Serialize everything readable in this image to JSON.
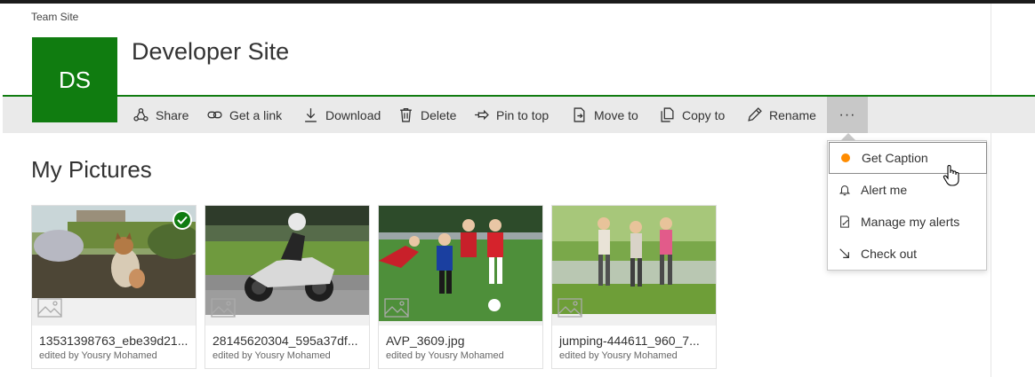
{
  "breadcrumb": "Team Site",
  "site": {
    "initials": "DS",
    "title": "Developer Site",
    "logo_color": "#107c10"
  },
  "commands": [
    {
      "label": "Share",
      "icon": "share-icon"
    },
    {
      "label": "Get a link",
      "icon": "link-icon"
    },
    {
      "label": "Download",
      "icon": "download-icon"
    },
    {
      "label": "Delete",
      "icon": "trash-icon"
    },
    {
      "label": "Pin to top",
      "icon": "pin-icon"
    },
    {
      "label": "Move to",
      "icon": "move-icon"
    },
    {
      "label": "Copy to",
      "icon": "copy-icon"
    },
    {
      "label": "Rename",
      "icon": "pencil-icon"
    }
  ],
  "more_label": "···",
  "menu": {
    "items": [
      {
        "label": "Get Caption",
        "icon": "orange-dot-icon",
        "hovered": true
      },
      {
        "label": "Alert me",
        "icon": "bell-icon"
      },
      {
        "label": "Manage my alerts",
        "icon": "manage-alerts-icon"
      },
      {
        "label": "Check out",
        "icon": "check-out-icon"
      }
    ]
  },
  "section_title": "My Pictures",
  "files": [
    {
      "name": "13531398763_ebe39d21...",
      "editor": "edited by Yousry Mohamed",
      "selected": true,
      "icon": "image-placeholder-icon"
    },
    {
      "name": "28145620304_595a37df...",
      "editor": "edited by Yousry Mohamed",
      "icon": "image-placeholder-icon"
    },
    {
      "name": "AVP_3609.jpg",
      "editor": "edited by Yousry Mohamed",
      "icon": "image-placeholder-icon"
    },
    {
      "name": "jumping-444611_960_7...",
      "editor": "edited by Yousry Mohamed",
      "icon": "image-placeholder-icon"
    }
  ],
  "colors": {
    "accent": "#107c10",
    "command_bar": "#eaeaea",
    "highlight_dot": "#ff8c00"
  }
}
